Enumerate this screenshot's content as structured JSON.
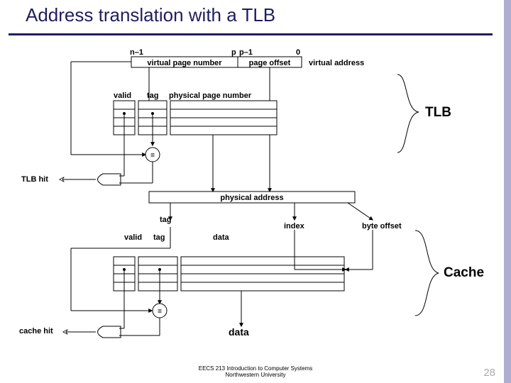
{
  "title": "Address translation with a TLB",
  "va_box": {
    "n1": "n–1",
    "p": "p",
    "p1": "p–1",
    "zero": "0",
    "vpn": "virtual page number",
    "po": "page offset",
    "va_label": "virtual address"
  },
  "tlb_table": {
    "valid": "valid",
    "tag": "tag",
    "ppn": "physical page number"
  },
  "tlb_label": "TLB",
  "tlb_hit": "TLB hit",
  "pa_label": "physical address",
  "pa_parts": {
    "tag": "tag",
    "index": "index",
    "byte_offset": "byte offset"
  },
  "cache_table": {
    "valid": "valid",
    "tag": "tag",
    "data_hdr": "data"
  },
  "cache_label": "Cache",
  "cache_hit": "cache hit",
  "data_out": "data",
  "footer_line1": "EECS 213 Introduction to Computer Systems",
  "footer_line2": "Northwestern University",
  "page_number": "28"
}
